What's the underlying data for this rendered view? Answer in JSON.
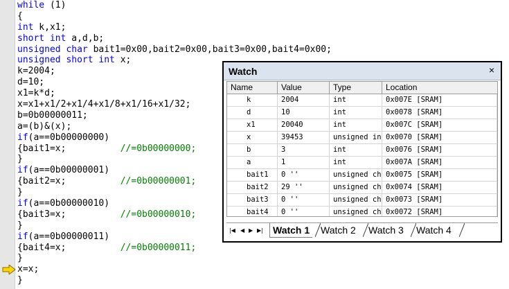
{
  "code": {
    "lines": [
      [
        {
          "t": "while",
          "c": "kw"
        },
        {
          "t": " (1)"
        }
      ],
      [
        {
          "t": "{"
        }
      ],
      [
        {
          "t": "int",
          "c": "kw"
        },
        {
          "t": " k,x1;"
        }
      ],
      [
        {
          "t": "short int",
          "c": "kw"
        },
        {
          "t": " a,d,b;"
        }
      ],
      [
        {
          "t": "unsigned char",
          "c": "kw"
        },
        {
          "t": " bait1=0x00,bait2=0x00,bait3=0x00,bait4=0x00;"
        }
      ],
      [
        {
          "t": "unsigned short int",
          "c": "kw"
        },
        {
          "t": " x;"
        }
      ],
      [
        {
          "t": "k=2004;"
        }
      ],
      [
        {
          "t": "d=10;"
        }
      ],
      [
        {
          "t": "x1=k*d;"
        }
      ],
      [
        {
          "t": "x=x1+x1/2+x1/4+x1/8+x1/16+x1/32;"
        }
      ],
      [
        {
          "t": "b=0b00000011;"
        }
      ],
      [
        {
          "t": "a=(b)&(x);"
        }
      ],
      [
        {
          "t": "if",
          "c": "kw"
        },
        {
          "t": "(a==0b00000000)"
        }
      ],
      [
        {
          "t": "{bait1=x;          "
        },
        {
          "t": "//=0b00000000;",
          "c": "cm"
        }
      ],
      [
        {
          "t": "}"
        }
      ],
      [
        {
          "t": "if",
          "c": "kw"
        },
        {
          "t": "(a==0b00000001)"
        }
      ],
      [
        {
          "t": "{bait2=x;          "
        },
        {
          "t": "//=0b00000001;",
          "c": "cm"
        }
      ],
      [
        {
          "t": "}"
        }
      ],
      [
        {
          "t": "if",
          "c": "kw"
        },
        {
          "t": "(a==0b00000010)"
        }
      ],
      [
        {
          "t": "{bait3=x;          "
        },
        {
          "t": "//=0b00000010;",
          "c": "cm"
        }
      ],
      [
        {
          "t": "}"
        }
      ],
      [
        {
          "t": "if",
          "c": "kw"
        },
        {
          "t": "(a==0b00000011)"
        }
      ],
      [
        {
          "t": "{bait4=x;          "
        },
        {
          "t": "//=0b00000011;",
          "c": "cm"
        }
      ],
      [
        {
          "t": "}"
        }
      ],
      [
        {
          "t": "x=x;"
        }
      ],
      [
        {
          "t": "}"
        }
      ]
    ],
    "exec_line_index": 24,
    "colors": {
      "keyword": "#0000ff",
      "comment": "#008000",
      "arrow": "#ffd700"
    }
  },
  "watch": {
    "title": "Watch",
    "close_label": "×",
    "columns": {
      "name": "Name",
      "value": "Value",
      "type": "Type",
      "location": "Location"
    },
    "rows": [
      {
        "name": "k",
        "value": "2004",
        "type": "int",
        "location": "0x007E [SRAM]"
      },
      {
        "name": "d",
        "value": "10",
        "type": "int",
        "location": "0x0078 [SRAM]"
      },
      {
        "name": "x1",
        "value": "20040",
        "type": "int",
        "location": "0x007C [SRAM]"
      },
      {
        "name": "x",
        "value": "39453",
        "type": "unsigned in",
        "location": "0x0070 [SRAM]"
      },
      {
        "name": "b",
        "value": "3",
        "type": "int",
        "location": "0x0076 [SRAM]"
      },
      {
        "name": "a",
        "value": "1",
        "type": "int",
        "location": "0x007A [SRAM]"
      },
      {
        "name": "bait1",
        "value": "0 ''",
        "type": "unsigned ch",
        "location": "0x0075 [SRAM]"
      },
      {
        "name": "bait2",
        "value": "29 ''",
        "type": "unsigned ch",
        "location": "0x0074 [SRAM]"
      },
      {
        "name": "bait3",
        "value": "0 ''",
        "type": "unsigned ch",
        "location": "0x0073 [SRAM]"
      },
      {
        "name": "bait4",
        "value": "0 ''",
        "type": "unsigned ch",
        "location": "0x0072 [SRAM]"
      }
    ],
    "nav_buttons": [
      "|◀",
      "◀",
      "▶",
      "▶|"
    ],
    "tabs": [
      {
        "label": "Watch 1",
        "active": true
      },
      {
        "label": "Watch 2",
        "active": false
      },
      {
        "label": "Watch 3",
        "active": false
      },
      {
        "label": "Watch 4",
        "active": false
      }
    ],
    "colors": {
      "titlebar": "#dbe3ef",
      "border": "#000000"
    }
  }
}
